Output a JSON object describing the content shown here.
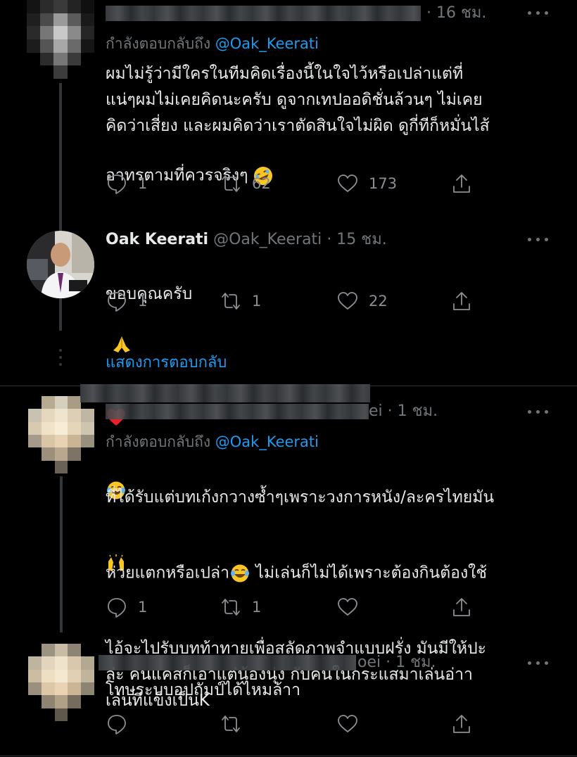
{
  "tweets": [
    {
      "time": "· 16 ชม.",
      "reply_prefix": "กำลังตอบกลับถึง",
      "reply_handle": "@Oak_Keerati",
      "text": "ผมไม่รู้ว่ามีใครในทีมคิดเรื่องนี้ในใจไว้หรือเปล่าแต่ที่\nแน่ๆผมไม่เคยคิดนะครับ ดูจากเทปออดิชั่นล้วนๆ ไม่เคย\nคิดว่าเสี่ยง และผมคิดว่าเราตัดสินใจไม่ผิด ดูกี่ทีก็หมั่นไส้\nอาทรตามที่ควรจริงๆ",
      "text_emoji": "rolling-on-floor-laughing-emoji",
      "counts": {
        "reply": "1",
        "retweet": "62",
        "like": "173"
      }
    },
    {
      "name": "Oak Keerati",
      "handle": "@Oak_Keerati",
      "time": "· 15 ชม.",
      "text": "ขอบคุณครับ",
      "text_emojis": [
        "folded-hands-emoji",
        "red-heart-emoji",
        "tears-of-joy-emoji",
        "raising-hands-emoji"
      ],
      "counts": {
        "reply": "1",
        "retweet": "1",
        "like": "22"
      }
    },
    {
      "name_tail": "ei",
      "time": "· 1 ชม.",
      "reply_prefix": "กำลังตอบกลับถึง",
      "reply_handle": "@Oak_Keerati",
      "text_line1": "ที่ได้รับแต่บทเก้งกวางซ้ำๆเพราะวงการหนัง/ละครไทยมัน",
      "text_line2a": "ห่วยแตกหรือเปล่า",
      "text_line2b": " ไม่เล่นก็ไม่ได้เพราะต้องกินต้องใช้",
      "text_rest": "ไอ้จะไปรับบทท้าทายเพื่อสลัดภาพจำแบบฝรั่ง มันมีให้ปะ\nล่ะ คนแคสก็เอาแต่น้องนุ่ง กับคนในกระแสมาเล่นอ่าา\nเล่นทีแข็งเป็นK",
      "counts": {
        "reply": "1",
        "retweet": "1",
        "like": ""
      }
    },
    {
      "name_tail": "oei",
      "time": "· 1 ชม.",
      "text": "โทษระบบอุปถัมป์ได้ไหมล้าา",
      "counts": {
        "reply": "",
        "retweet": "",
        "like": ""
      }
    }
  ],
  "show_replies_label": "แสดงการตอบกลับ",
  "colors": {
    "background": "#000000",
    "text": "#e7e9ea",
    "muted": "#71767b",
    "accent": "#1d9bf0",
    "divider": "#2f3336"
  },
  "icons": [
    "more-icon",
    "reply-icon",
    "retweet-icon",
    "like-icon",
    "share-icon"
  ]
}
